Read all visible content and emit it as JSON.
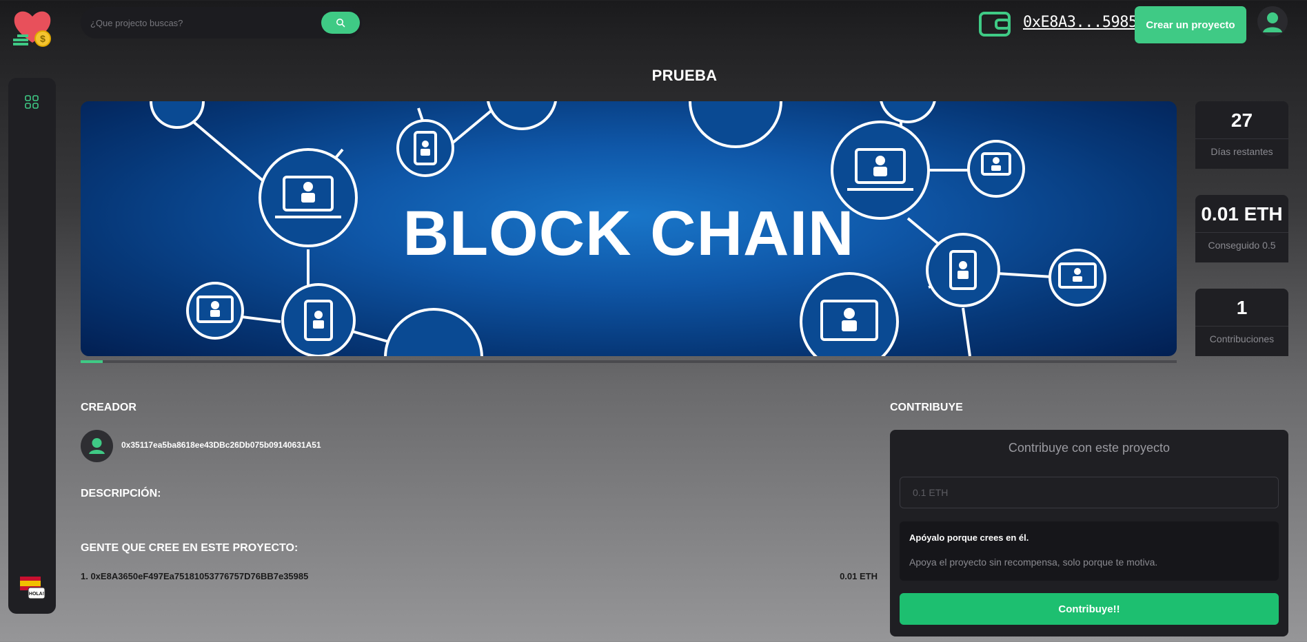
{
  "header": {
    "search_placeholder": "¿Que projecto buscas?",
    "wallet_address": "0xE8A3...5985",
    "create_button": "Crear un proyecto"
  },
  "project": {
    "title": "PRUEBA",
    "banner_text": "BLOCK CHAIN",
    "progress_fraction": 0.02
  },
  "stats": [
    {
      "value": "27",
      "label": "Días restantes"
    },
    {
      "value": "0.01 ETH",
      "label": "Conseguido 0.5"
    },
    {
      "value": "1",
      "label": "Contribuciones"
    }
  ],
  "creator": {
    "heading": "CREADOR",
    "address": "0x35117ea5ba8618ee43DBc26Db075b09140631A51"
  },
  "description": {
    "heading": "DESCRIPCIÓN:"
  },
  "believers": {
    "heading": "GENTE QUE CREE EN ESTE PROYECTO:",
    "items": [
      {
        "entry": "1. 0xE8A3650eF497Ea75181053776757D76BB7e35985",
        "amount": "0.01 ETH"
      }
    ]
  },
  "contribute": {
    "heading": "CONTRIBUYE",
    "box_title": "Contribuye con este proyecto",
    "input_placeholder": "0.1 ETH",
    "reward_title": "Apóyalo porque crees en él.",
    "reward_description": "Apoya el proyecto sin recompensa, solo porque te motiva.",
    "button": "Contribuye!!"
  },
  "colors": {
    "accent": "#3fca85",
    "button_green": "#1dbf70",
    "panel": "#1f1f23"
  },
  "icons": [
    "logo-heart-coin-icon",
    "search-icon",
    "wallet-icon",
    "user-avatar-icon",
    "grid-icon",
    "language-flag-icon"
  ]
}
